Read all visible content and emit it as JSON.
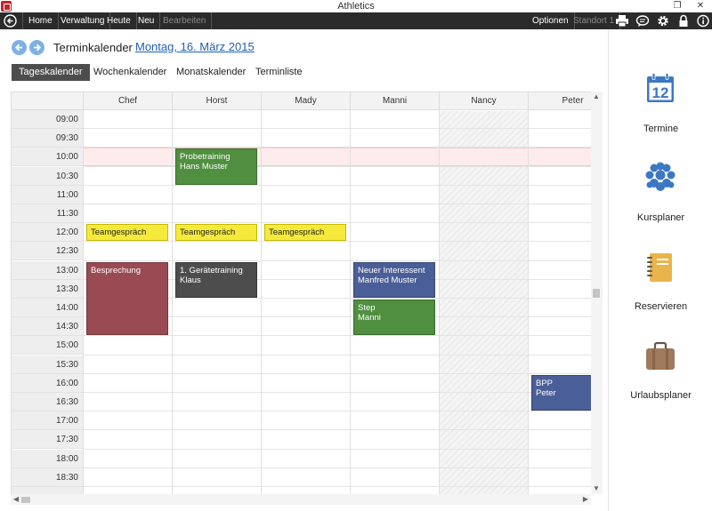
{
  "window": {
    "title": "Athletics",
    "restore_glyph": "❐",
    "close_glyph": "✕"
  },
  "menu": {
    "items": [
      {
        "label": "Home"
      },
      {
        "label": "Verwaltung"
      },
      {
        "label": "Heute"
      },
      {
        "label": "Neu"
      },
      {
        "label": "Bearbeiten",
        "disabled": true
      }
    ],
    "options_label": "Optionen",
    "location_label": "Standort 1",
    "icons": [
      "print-icon",
      "chat-icon",
      "gear-icon",
      "lock-icon",
      "info-icon"
    ]
  },
  "header": {
    "title": "Terminkalender",
    "date": "Montag, 16. März 2015"
  },
  "tabs": [
    {
      "label": "Tageskalender",
      "active": true
    },
    {
      "label": "Wochenkalender",
      "active": false
    },
    {
      "label": "Monatskalender",
      "active": false
    },
    {
      "label": "Terminliste",
      "active": false
    }
  ],
  "calendar": {
    "columns": [
      "Chef",
      "Horst",
      "Mady",
      "Manni",
      "Nancy",
      "Peter"
    ],
    "times": [
      "09:00",
      "09:30",
      "10:00",
      "10:30",
      "11:00",
      "11:30",
      "12:00",
      "12:30",
      "13:00",
      "13:30",
      "14:00",
      "14:30",
      "15:00",
      "15:30",
      "16:00",
      "16:30",
      "17:00",
      "17:30",
      "18:00",
      "18:30"
    ],
    "highlight_time": "10:00",
    "unavailable_column": "Nancy",
    "events": [
      {
        "title": "Probetraining",
        "subtitle": "Hans Muster",
        "column": 1,
        "start": "10:00",
        "end": "11:00",
        "color": "#4f8f3f"
      },
      {
        "title": "Teamgespräch",
        "subtitle": "",
        "column": 0,
        "start": "12:00",
        "end": "12:30",
        "color": "#f5ea3b"
      },
      {
        "title": "Teamgespräch",
        "subtitle": "",
        "column": 1,
        "start": "12:00",
        "end": "12:30",
        "color": "#f5ea3b"
      },
      {
        "title": "Teamgespräch",
        "subtitle": "",
        "column": 2,
        "start": "12:00",
        "end": "12:30",
        "color": "#f5ea3b"
      },
      {
        "title": "Besprechung",
        "subtitle": "",
        "column": 0,
        "start": "13:00",
        "end": "15:00",
        "color": "#994a52"
      },
      {
        "title": "1. Gerätetraining",
        "subtitle": "Klaus",
        "column": 1,
        "start": "13:00",
        "end": "14:00",
        "color": "#4d4d4d"
      },
      {
        "title": "Neuer Interessent",
        "subtitle": "Manfred Muster",
        "column": 3,
        "start": "13:00",
        "end": "14:00",
        "color": "#4a5e97"
      },
      {
        "title": "Step",
        "subtitle": "Manni",
        "column": 3,
        "start": "14:00",
        "end": "15:00",
        "color": "#4f8f3f"
      },
      {
        "title": "BPP",
        "subtitle": "Peter",
        "column": 5,
        "start": "16:00",
        "end": "17:00",
        "color": "#4a5e97"
      }
    ]
  },
  "sidepanel": {
    "items": [
      {
        "label": "Termine",
        "icon": "calendar-icon",
        "badge": "12",
        "color": "#3b78c4"
      },
      {
        "label": "Kursplaner",
        "icon": "group-icon",
        "color": "#3b78c4"
      },
      {
        "label": "Reservieren",
        "icon": "notebook-icon",
        "color": "#e9b44c"
      },
      {
        "label": "Urlaubsplaner",
        "icon": "suitcase-icon",
        "color": "#a07a5c"
      }
    ]
  }
}
